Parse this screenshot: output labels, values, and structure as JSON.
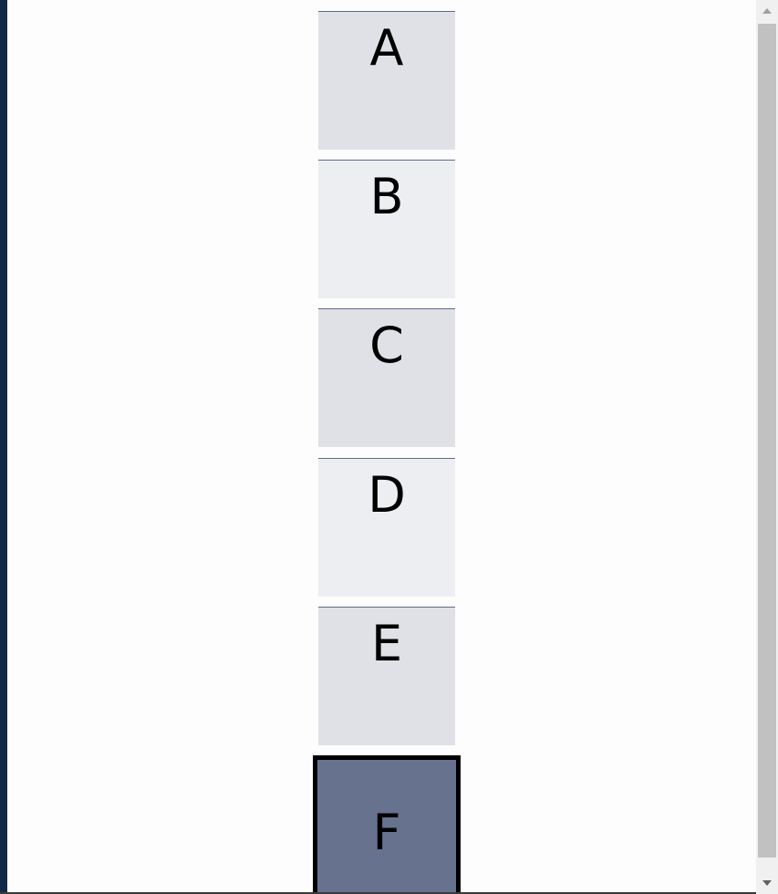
{
  "tiles": [
    {
      "label": "A",
      "selected": false
    },
    {
      "label": "B",
      "selected": false
    },
    {
      "label": "C",
      "selected": false
    },
    {
      "label": "D",
      "selected": false
    },
    {
      "label": "E",
      "selected": false
    },
    {
      "label": "F",
      "selected": true
    }
  ],
  "icons": {
    "scroll_up": "scroll-up-arrow-icon",
    "scroll_down": "scroll-down-arrow-icon"
  },
  "colors": {
    "tile_light_1": "#e0e1e6",
    "tile_light_2": "#edeef2",
    "tile_selected": "#67728f",
    "tile_selected_border": "#000000",
    "left_edge": "#0e2a47"
  }
}
